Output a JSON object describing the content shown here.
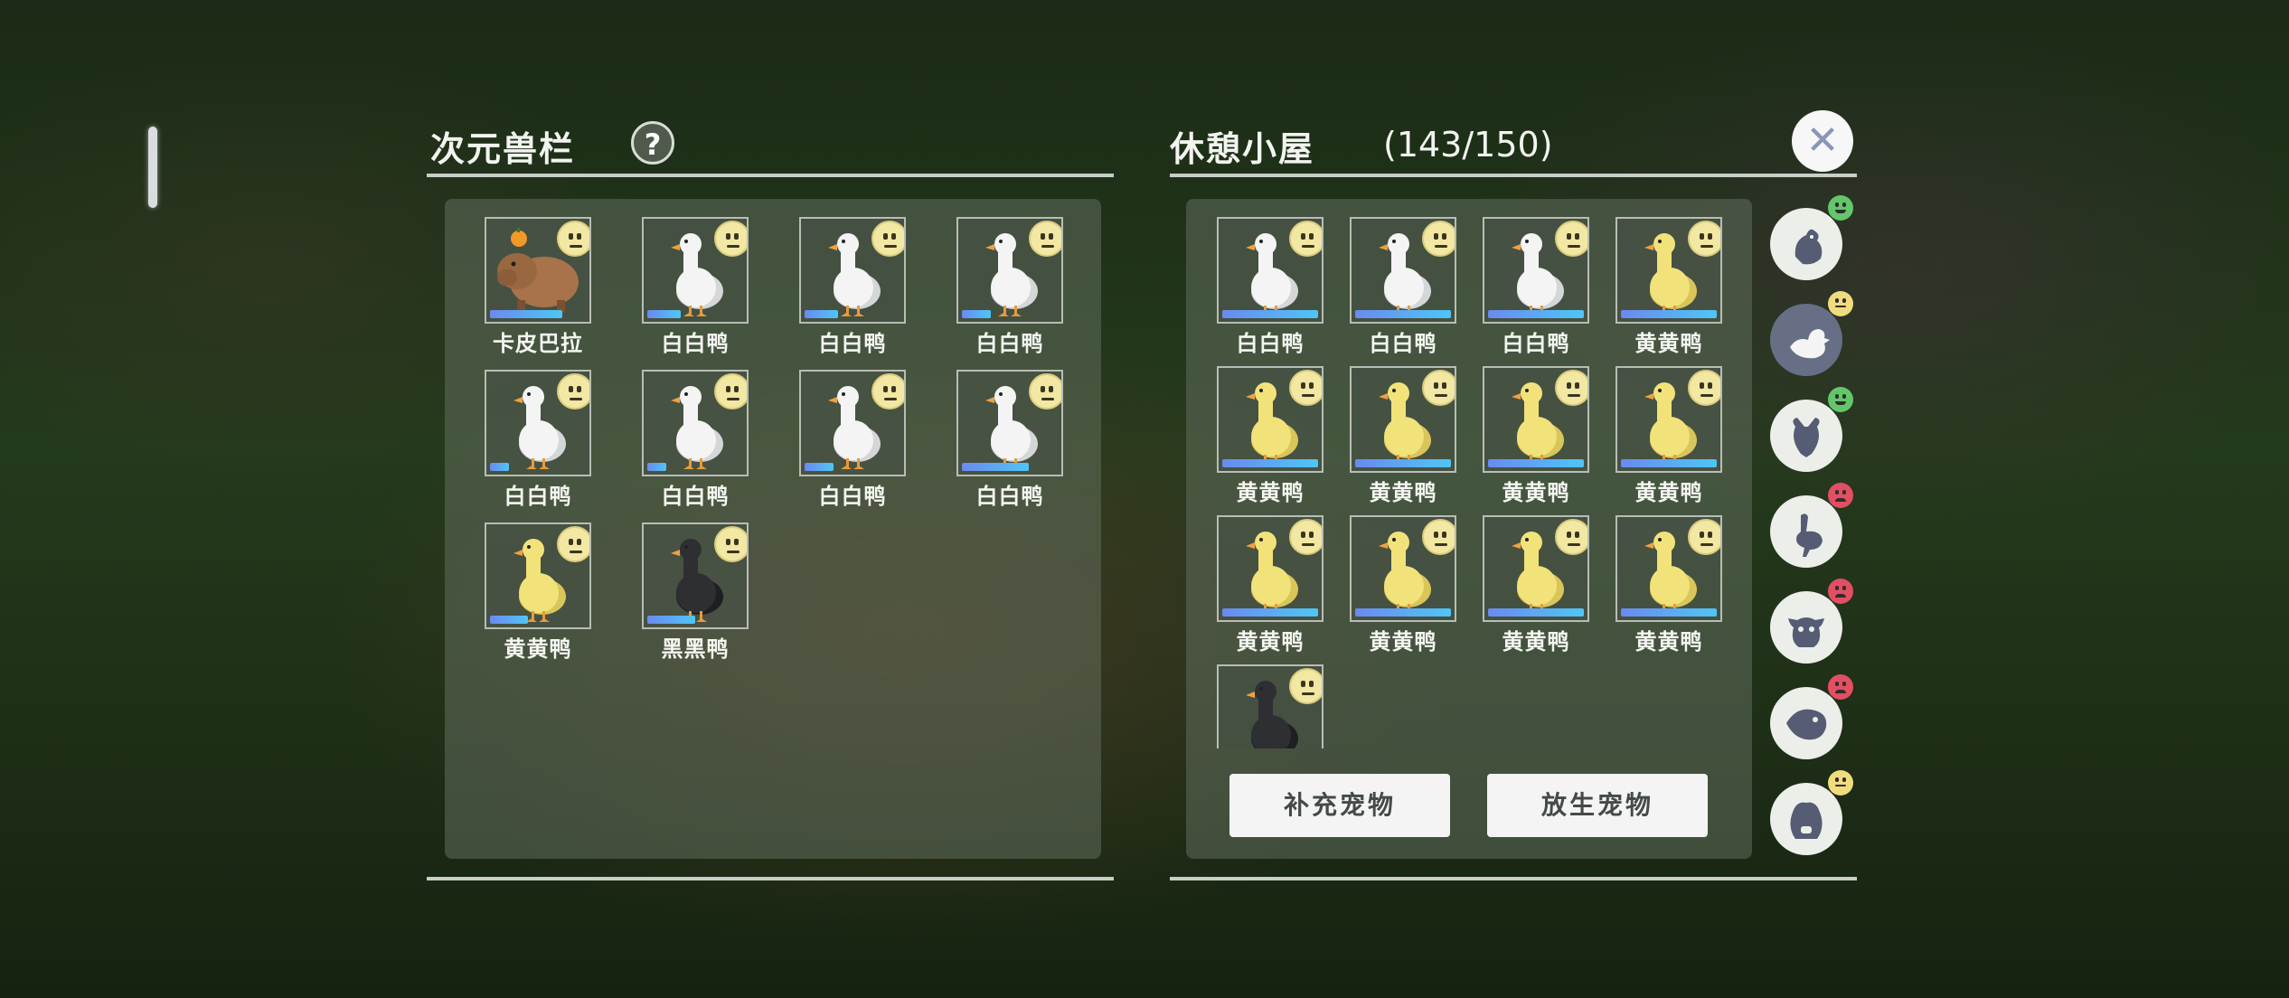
{
  "left_panel": {
    "title": "次元兽栏",
    "help_label": "?"
  },
  "right_panel": {
    "title": "休憩小屋",
    "capacity": "(143/150)"
  },
  "close_label": "✕",
  "buttons": {
    "refill": "补充宠物",
    "release": "放生宠物"
  },
  "pen_pets": [
    {
      "name": "卡皮巴拉",
      "kind": "capybara",
      "progress": 0.75
    },
    {
      "name": "白白鸭",
      "kind": "white",
      "progress": 0.35
    },
    {
      "name": "白白鸭",
      "kind": "white",
      "progress": 0.35
    },
    {
      "name": "白白鸭",
      "kind": "white",
      "progress": 0.3
    },
    {
      "name": "白白鸭",
      "kind": "white",
      "progress": 0.2
    },
    {
      "name": "白白鸭",
      "kind": "white",
      "progress": 0.2
    },
    {
      "name": "白白鸭",
      "kind": "white",
      "progress": 0.3
    },
    {
      "name": "白白鸭",
      "kind": "white",
      "progress": 0.7
    },
    {
      "name": "黄黄鸭",
      "kind": "yellow",
      "progress": 0.4
    },
    {
      "name": "黑黑鸭",
      "kind": "black",
      "progress": 0.5
    }
  ],
  "hut_pets": [
    {
      "name": "白白鸭",
      "kind": "white",
      "progress": 1.0
    },
    {
      "name": "白白鸭",
      "kind": "white",
      "progress": 1.0
    },
    {
      "name": "白白鸭",
      "kind": "white",
      "progress": 1.0
    },
    {
      "name": "黄黄鸭",
      "kind": "yellow",
      "progress": 1.0
    },
    {
      "name": "黄黄鸭",
      "kind": "yellow",
      "progress": 1.0
    },
    {
      "name": "黄黄鸭",
      "kind": "yellow",
      "progress": 1.0
    },
    {
      "name": "黄黄鸭",
      "kind": "yellow",
      "progress": 1.0
    },
    {
      "name": "黄黄鸭",
      "kind": "yellow",
      "progress": 1.0
    },
    {
      "name": "黄黄鸭",
      "kind": "yellow",
      "progress": 1.0
    },
    {
      "name": "黄黄鸭",
      "kind": "yellow",
      "progress": 1.0
    },
    {
      "name": "黄黄鸭",
      "kind": "yellow",
      "progress": 1.0
    },
    {
      "name": "黄黄鸭",
      "kind": "yellow",
      "progress": 1.0
    },
    {
      "name": "",
      "kind": "black",
      "progress": 0
    }
  ],
  "categories": [
    {
      "icon": "chicken-icon",
      "mood": "happy",
      "selected": false
    },
    {
      "icon": "duck-icon",
      "mood": "neutral",
      "selected": true
    },
    {
      "icon": "goat-icon",
      "mood": "happy",
      "selected": false
    },
    {
      "icon": "ostrich-icon",
      "mood": "sad",
      "selected": false
    },
    {
      "icon": "cow-icon",
      "mood": "sad",
      "selected": false
    },
    {
      "icon": "fish-icon",
      "mood": "sad",
      "selected": false
    },
    {
      "icon": "capybara-icon",
      "mood": "neutral",
      "selected": false
    }
  ],
  "colors": {
    "white_duck": "#f4f4f4",
    "yellow_duck": "#f2e27a",
    "black_duck": "#2e2f33",
    "capybara": "#a8734a",
    "bar": "#4fc6f5"
  }
}
